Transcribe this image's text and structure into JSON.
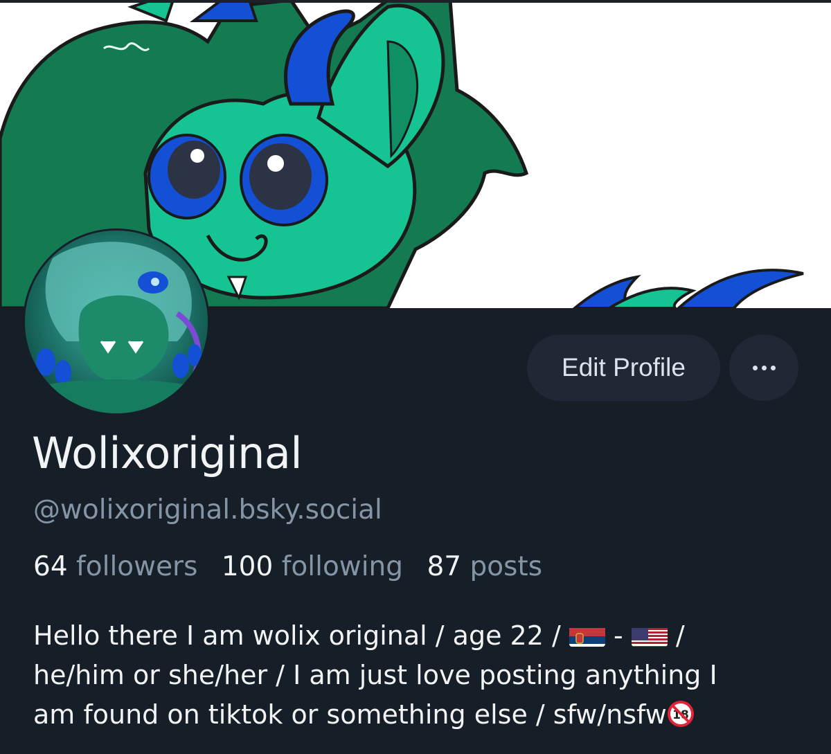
{
  "profile": {
    "display_name": "Wolixoriginal",
    "handle": "@wolixoriginal.bsky.social",
    "edit_button_label": "Edit Profile",
    "more_button_label": "•••"
  },
  "stats": {
    "followers_count": "64",
    "followers_label": "followers",
    "following_count": "100",
    "following_label": "following",
    "posts_count": "87",
    "posts_label": "posts"
  },
  "bio": {
    "line1_a": "Hello there I am wolix original / age 22 /",
    "line1_sep": "-",
    "line1_end": "/",
    "line2": "he/him or she/her / I am just love posting anything I",
    "line3": "am found on tiktok or something else / sfw/nsfw",
    "flag1": "serbia-flag-icon",
    "flag2": "us-flag-icon",
    "badge": "no-under-18-icon"
  },
  "colors": {
    "background": "#161e27",
    "button_bg": "#1e2935",
    "text_primary": "#f1f3f5",
    "text_secondary": "#8595a6"
  }
}
